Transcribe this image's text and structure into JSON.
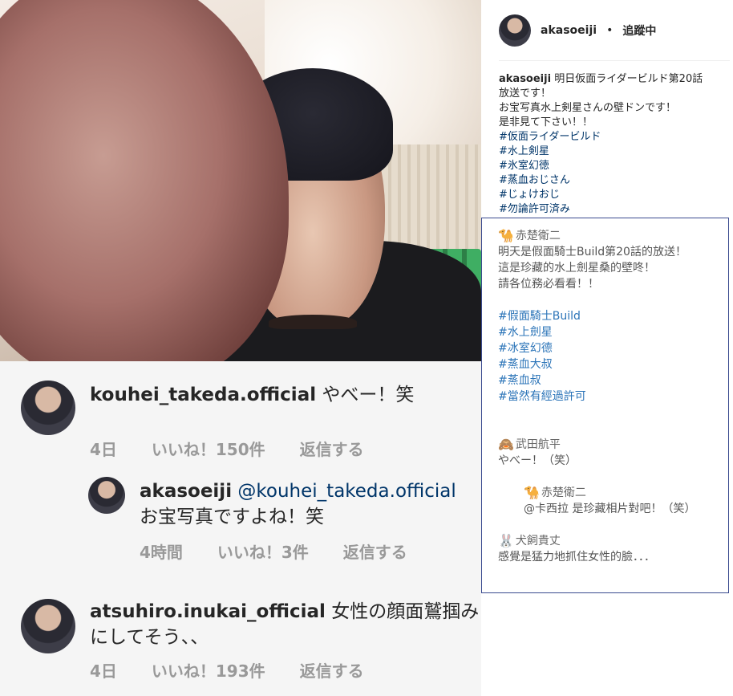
{
  "post": {
    "username": "akasoeiji",
    "separator": "•",
    "follow_status": "追蹤中",
    "caption_user": "akasoeiji",
    "caption_lines": [
      "明日仮面ライダービルド第20話",
      "放送です！",
      "お宝写真水上剣星さんの壁ドンです！",
      "是非見て下さい！！"
    ],
    "hashtags": [
      "#仮面ライダービルド",
      "#水上剣星",
      "#氷室幻徳",
      "#蒸血おじさん",
      "#じょけおじ",
      "#勿論許可済み"
    ]
  },
  "translation": {
    "author": "赤楚衛二",
    "author_emoji": "🐪",
    "lines": [
      "明天是假面騎士Build第20話的放送！",
      "這是珍藏的水上劍星桑的壁咚！",
      "請各位務必看看！！"
    ],
    "hashtags": [
      "#假面騎士Build",
      "#水上劍星",
      "#冰室幻德",
      "#蒸血大叔",
      "#蒸血叔",
      "#當然有經過許可"
    ],
    "comments": [
      {
        "author": "武田航平",
        "emoji": "🙈",
        "text": "やべー！（笑）"
      },
      {
        "author": "赤楚衛二",
        "emoji": "🐪",
        "text": "@卡西拉 是珍藏相片對吧！（笑）"
      },
      {
        "author": "犬飼貴丈",
        "emoji": "🐰",
        "text": "感覺是猛力地抓住女性的臉．．．"
      }
    ]
  },
  "comments": [
    {
      "user": "kouhei_takeda.official",
      "mention": "",
      "text": "やべー！笑",
      "time": "4日",
      "likes": "いいね！150件",
      "reply": "返信する"
    },
    {
      "user": "akasoeiji",
      "mention": "@kouhei_takeda.official",
      "text": "お宝写真ですよね！笑",
      "time": "4時間",
      "likes": "いいね！3件",
      "reply": "返信する"
    },
    {
      "user": "atsuhiro.inukai_official",
      "mention": "",
      "text": "女性の顔面鷲掴み",
      "text2": "にしてそう、、",
      "time": "4日",
      "likes": "いいね！193件",
      "reply": "返信する"
    }
  ]
}
